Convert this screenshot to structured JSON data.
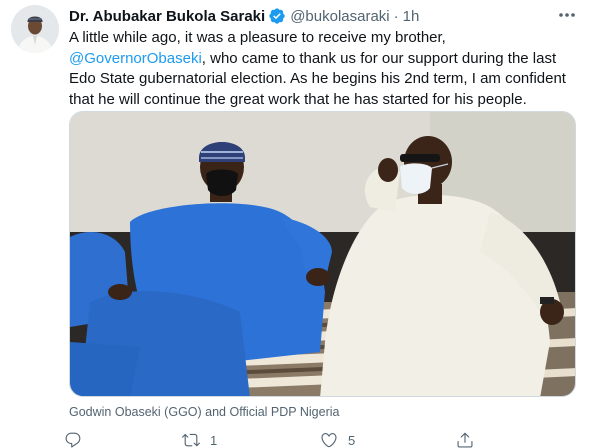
{
  "author": {
    "name": "Dr. Abubakar Bukola Saraki",
    "handle": "@bukolasaraki",
    "separator": "·",
    "time": "1h"
  },
  "tweet": {
    "line1": "A little while ago, it was a pleasure to receive my brother,",
    "mention": "@GovernorObaseki",
    "line2_rest": ", who came to thank us for our support during the last",
    "line3": "Edo State gubernatorial election. As he begins his 2nd term, I am confident",
    "line4": "that he will continue the great work that he has started for his people."
  },
  "media": {
    "caption": "Godwin Obaseki (GGO) and Official PDP Nigeria"
  },
  "actions": {
    "reply_count": "",
    "retweet_count": "1",
    "like_count": "5"
  },
  "colors": {
    "accent": "#1d9bf0",
    "muted": "#536471",
    "text": "#0f1419"
  },
  "icons": {
    "verified": "verified-badge-icon",
    "more": "more-dots-icon",
    "reply": "reply-icon",
    "retweet": "retweet-icon",
    "like": "heart-icon",
    "share": "share-icon"
  }
}
